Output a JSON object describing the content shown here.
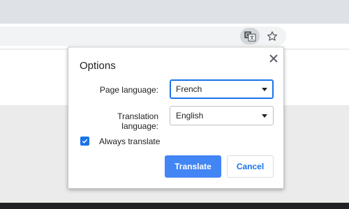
{
  "browser": {
    "translate_icon": "translate-icon",
    "bookmark_icon": "star-icon"
  },
  "bubble": {
    "title": "Options",
    "close_icon": "close-icon",
    "page_language": {
      "label": "Page language:",
      "value": "French"
    },
    "translation_language": {
      "label": "Translation language:",
      "value": "English"
    },
    "always_translate": {
      "label": "Always translate",
      "checked": true
    },
    "translate_button": "Translate",
    "cancel_button": "Cancel"
  },
  "colors": {
    "accent": "#1a73e8",
    "primary_button": "#4285f4"
  }
}
